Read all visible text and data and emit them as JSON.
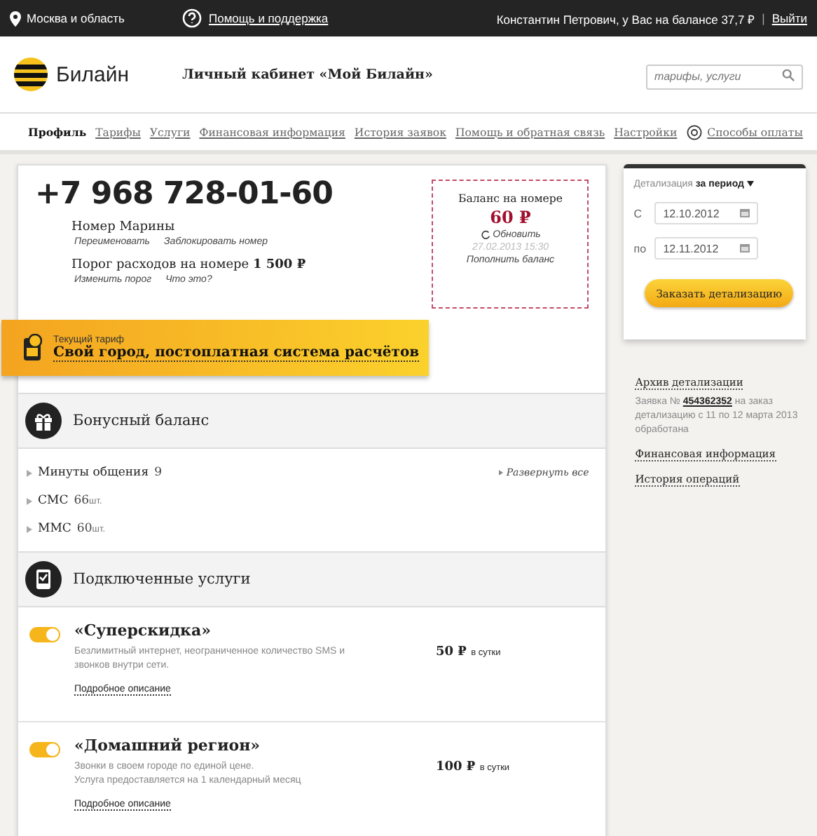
{
  "top_bar": {
    "region": "Москва и область",
    "help": "Помощь и поддержка",
    "user_balance": "Константин Петрович, у Вас на балансе 37,7 ₽",
    "separator": "|",
    "logout": "Выйти"
  },
  "header": {
    "logo_text": "Билайн",
    "title": "Личный кабинет «Мой Билайн»",
    "search": {
      "placeholder": "тарифы, услуги"
    }
  },
  "nav": [
    {
      "label": "Профиль",
      "selected": true,
      "kind": "link"
    },
    {
      "label": "Тарифы",
      "selected": false,
      "kind": "link"
    },
    {
      "label": "Услуги",
      "selected": false,
      "kind": "link"
    },
    {
      "label": "Финансовая информация",
      "selected": false,
      "kind": "link"
    },
    {
      "label": "История заявок",
      "selected": false,
      "kind": "link"
    },
    {
      "label": "Помощь и обратная связь",
      "selected": false,
      "kind": "link"
    },
    {
      "label": "Настройки",
      "selected": false,
      "kind": "link"
    },
    {
      "label": "Способы оплаты",
      "selected": false,
      "kind": "payment"
    }
  ],
  "profile": {
    "phone": "+7 968 728-01-60",
    "name": "Номер Марины",
    "name_actions": [
      "Переименовать",
      "Заблокировать номер"
    ],
    "threshold": "Порог расходов на номере **1 500 ₽**",
    "threshold_actions": [
      "Изменить порог",
      "Что это?"
    ]
  },
  "balance_box": {
    "title": "Баланс на номере",
    "amount": "60 ₽",
    "refresh": "Обновить",
    "timestamp": "27.02.2013 15:30",
    "topup": "Пополнить баланс"
  },
  "tariff": {
    "caption": "Текущий тариф",
    "name": "Свой город, постоплатная система расчётов"
  },
  "bonus": {
    "title": "Бонусный баланс",
    "expand": "Развернуть все",
    "items": [
      {
        "label": "Минуты общения",
        "value": "9"
      },
      {
        "label": "СМС",
        "value": "66",
        "unit": "шт."
      },
      {
        "label": "ММС",
        "value": "60",
        "unit": "шт."
      }
    ]
  },
  "services": {
    "title": "Подключенные услуги",
    "items": [
      {
        "name": "«Суперскидка»",
        "on": true,
        "description": "Безлимитный интернет, неограниченное количество SMS и звонков внутри сети.",
        "price": "50 ₽",
        "unit": "в сутки",
        "more": "Подробное описание"
      },
      {
        "name": "«Домашний регион»",
        "on": true,
        "description": "Звонки в своем городе по единой цене.\nУслуга предоставляется на 1 календарный месяц",
        "price": "100 ₽",
        "unit": "в сутки",
        "more": "Подробное описание"
      }
    ]
  },
  "sidebar": {
    "detail": {
      "label": "Детализация",
      "period": "за период",
      "from_label": "С",
      "from_date": "12.10.2012",
      "to_label": "по",
      "to_date": "12.11.2012",
      "button": "Заказать детализацию"
    },
    "archive": {
      "title": "Архив детализации",
      "text_before": "Заявка №",
      "link": "454362352",
      "text_after": "на заказ детализацию с 11 по 12 марта 2013 обработана"
    },
    "links": [
      "Финансовая информация",
      "История операций"
    ]
  }
}
